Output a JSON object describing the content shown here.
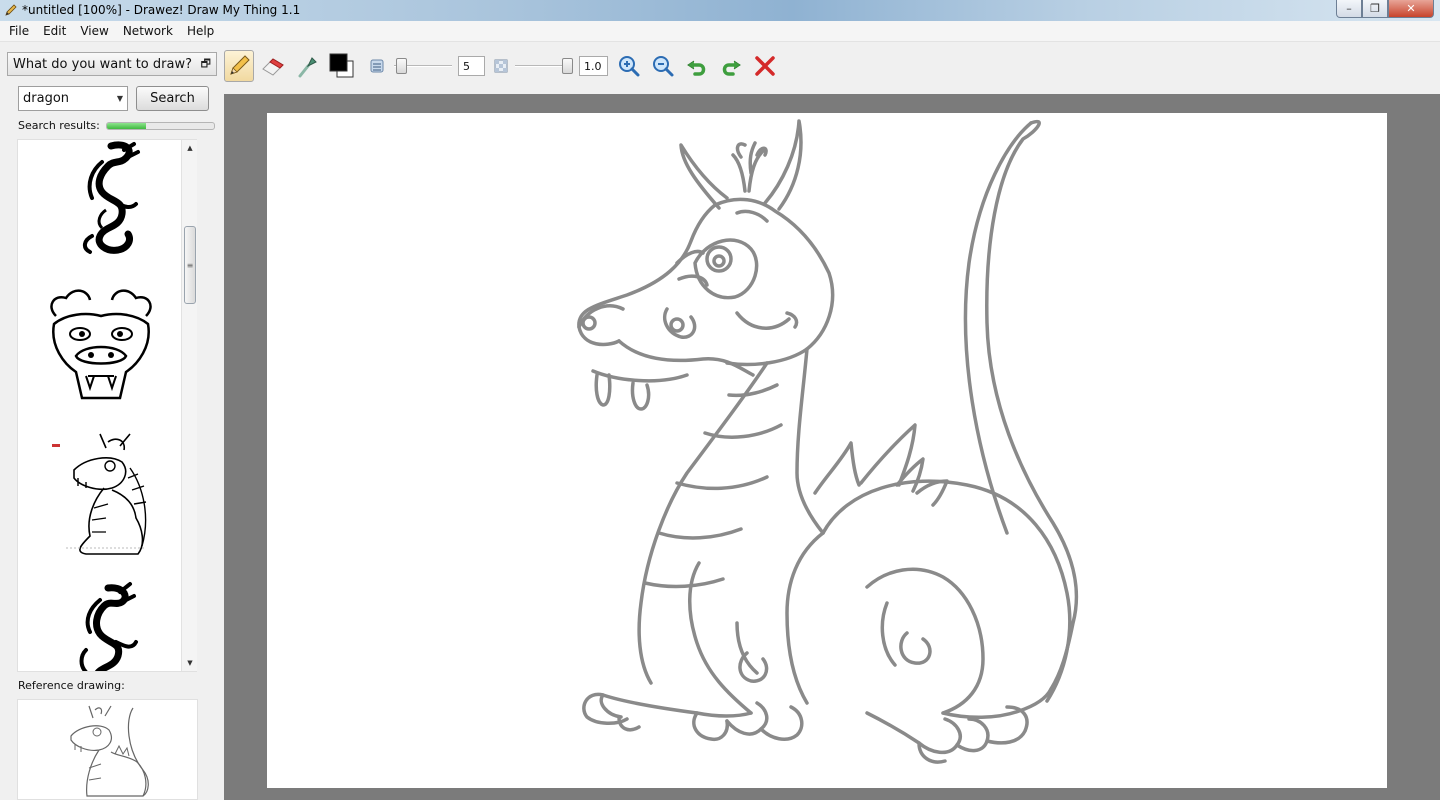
{
  "window": {
    "title": "*untitled [100%] - Drawez! Draw My Thing 1.1",
    "controls": {
      "minimize": "–",
      "maximize": "❐",
      "close": "✕"
    }
  },
  "menu": [
    "File",
    "Edit",
    "View",
    "Network",
    "Help"
  ],
  "panel": {
    "title": "What do you want to draw?",
    "restore_glyph": "🗗",
    "search_value": "dragon",
    "search_button": "Search",
    "results_label": "Search results:",
    "results_progress": 0.37,
    "results": [
      "tribal-dragon",
      "dragon-face",
      "cartoon-dragon-sitting",
      "tribal-dragon-2"
    ],
    "reference_label": "Reference drawing:"
  },
  "toolbar": {
    "tools": [
      "pencil-icon",
      "eraser-icon",
      "eyedropper-icon",
      "color-swatch",
      "brush-size-icon",
      "opacity-icon",
      "zoom-in-icon",
      "zoom-out-icon",
      "undo-icon",
      "redo-icon",
      "clear-icon"
    ],
    "brush_size": "5",
    "opacity": "1.0",
    "brush_size_fraction": 0.05,
    "opacity_fraction": 1.0,
    "primary_color": "#000000",
    "secondary_color": "#ffffff"
  },
  "colors": {
    "canvas_bg": "#7b7b7b",
    "drawing_stroke": "#8a8a8a",
    "progress": "#3fb93f"
  }
}
